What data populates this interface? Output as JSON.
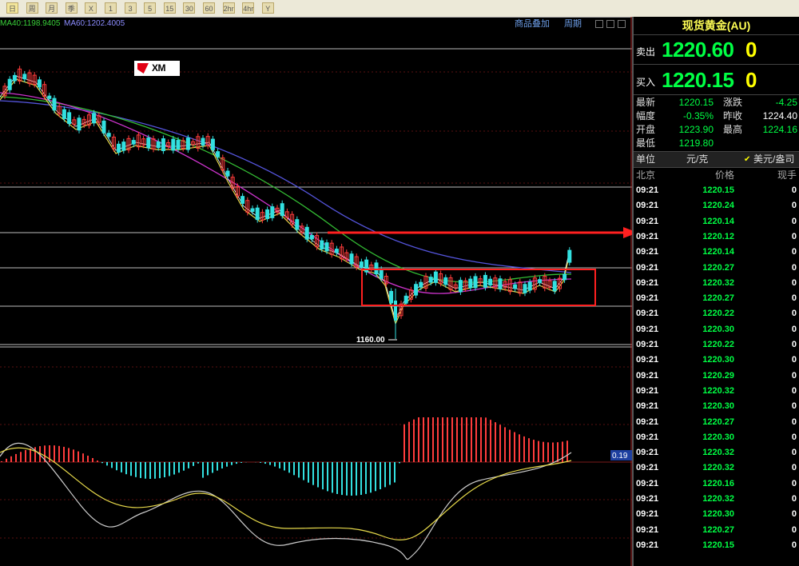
{
  "toolbar": {
    "buttons": [
      "日",
      "周",
      "月",
      "季",
      "X",
      "1",
      "3",
      "5",
      "15",
      "30",
      "60",
      "2hr",
      "4hr",
      "Y"
    ]
  },
  "chart": {
    "ma40_label": "MA40:1198.9405",
    "ma60_label": "MA60:1202.4005",
    "link_overlay": "商品叠加",
    "link_period": "周期",
    "low_marker": "1160.00",
    "logo": "XM",
    "macd_value": "0.19",
    "colors": {
      "up": "#ff3c3c",
      "down": "#33e0e0",
      "ma1": "#ffffff",
      "ma2": "#e5d84a",
      "ma3": "#cc33cc",
      "ma4": "#33bb33",
      "ma5": "#5555dd",
      "highlight": "#ff2020"
    }
  },
  "panel": {
    "title": "现货黄金(AU)",
    "sell_label": "卖出",
    "sell_price": "1220.60",
    "sell_vol": "0",
    "buy_label": "买入",
    "buy_price": "1220.15",
    "buy_vol": "0",
    "stats": {
      "latest_label": "最新",
      "latest": "1220.15",
      "change_label": "涨跌",
      "change": "-4.25",
      "amp_label": "幅度",
      "amp": "-0.35%",
      "prev_label": "昨收",
      "prev": "1224.40",
      "open_label": "开盘",
      "open": "1223.90",
      "high_label": "最高",
      "high": "1224.16",
      "low_label": "最低",
      "low": "1219.80"
    },
    "unit_label": "单位",
    "unit_yuan": "元/克",
    "unit_usd": "美元/盎司",
    "hdr_time": "北京",
    "hdr_price": "价格",
    "hdr_vol": "现手",
    "ticks": [
      {
        "time": "09:21",
        "price": "1220.15",
        "vol": "0"
      },
      {
        "time": "09:21",
        "price": "1220.24",
        "vol": "0"
      },
      {
        "time": "09:21",
        "price": "1220.14",
        "vol": "0"
      },
      {
        "time": "09:21",
        "price": "1220.12",
        "vol": "0"
      },
      {
        "time": "09:21",
        "price": "1220.14",
        "vol": "0"
      },
      {
        "time": "09:21",
        "price": "1220.27",
        "vol": "0"
      },
      {
        "time": "09:21",
        "price": "1220.32",
        "vol": "0"
      },
      {
        "time": "09:21",
        "price": "1220.27",
        "vol": "0"
      },
      {
        "time": "09:21",
        "price": "1220.22",
        "vol": "0"
      },
      {
        "time": "09:21",
        "price": "1220.30",
        "vol": "0"
      },
      {
        "time": "09:21",
        "price": "1220.22",
        "vol": "0"
      },
      {
        "time": "09:21",
        "price": "1220.30",
        "vol": "0"
      },
      {
        "time": "09:21",
        "price": "1220.29",
        "vol": "0"
      },
      {
        "time": "09:21",
        "price": "1220.32",
        "vol": "0"
      },
      {
        "time": "09:21",
        "price": "1220.30",
        "vol": "0"
      },
      {
        "time": "09:21",
        "price": "1220.27",
        "vol": "0"
      },
      {
        "time": "09:21",
        "price": "1220.30",
        "vol": "0"
      },
      {
        "time": "09:21",
        "price": "1220.32",
        "vol": "0"
      },
      {
        "time": "09:21",
        "price": "1220.32",
        "vol": "0"
      },
      {
        "time": "09:21",
        "price": "1220.16",
        "vol": "0"
      },
      {
        "time": "09:21",
        "price": "1220.32",
        "vol": "0"
      },
      {
        "time": "09:21",
        "price": "1220.30",
        "vol": "0"
      },
      {
        "time": "09:21",
        "price": "1220.27",
        "vol": "0"
      },
      {
        "time": "09:21",
        "price": "1220.15",
        "vol": "0"
      }
    ]
  }
}
